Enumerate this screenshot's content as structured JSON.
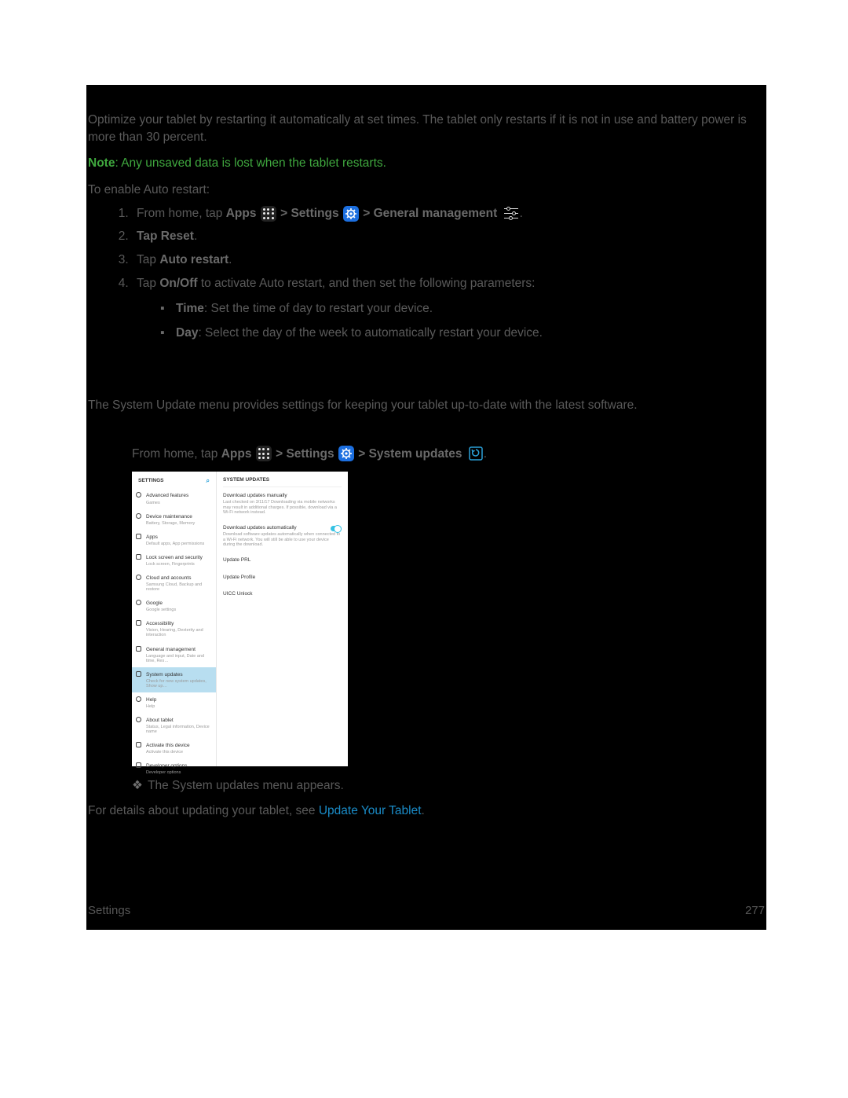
{
  "section1": {
    "intro": "Optimize your tablet by restarting it automatically at set times. The tablet only restarts if it is not in use and battery power is more than 30 percent.",
    "noteLabel": "Note",
    "noteText": ": Any unsaved data is lost when the tablet restarts.",
    "enableLine": "To enable Auto restart:",
    "step1_pre": "From home, tap ",
    "apps": "Apps",
    "gt": " > ",
    "settings": "Settings",
    "genmgmt": "General management",
    "step2_a": "Tap Reset",
    "step2_b": ".",
    "step3_a": "Tap ",
    "step3_b": "Auto restart",
    "step3_c": ".",
    "step4_a": "Tap ",
    "step4_b": "On/Off",
    "step4_c": " to activate Auto restart, and then set the following parameters:",
    "bullet1_a": "Time",
    "bullet1_b": ": Set the time of day to restart your device.",
    "bullet2_a": "Day",
    "bullet2_b": ": Select the day of the week to automatically restart your device."
  },
  "section2": {
    "intro": "The System Update menu provides settings for keeping your tablet up-to-date with the latest software.",
    "step1_pre": "From home, tap ",
    "apps": "Apps",
    "gt": " > ",
    "settings": "Settings",
    "sysupd": "System updates",
    "result": "The System updates menu appears.",
    "details_pre": "For details about updating your tablet, see ",
    "linkText": "Update Your Tablet",
    "details_post": "."
  },
  "mock": {
    "sideHeader": "SETTINGS",
    "mainHeader": "SYSTEM UPDATES",
    "sideItems": [
      {
        "title": "Advanced features",
        "sub": "Games",
        "color": "c-orange",
        "shape": "circle"
      },
      {
        "title": "Device maintenance",
        "sub": "Battery, Storage, Memory",
        "color": "c-teal",
        "shape": "circle"
      },
      {
        "title": "Apps",
        "sub": "Default apps, App permissions",
        "color": "c-pink",
        "shape": ""
      },
      {
        "title": "Lock screen and security",
        "sub": "Lock screen, Fingerprints",
        "color": "c-blue",
        "shape": ""
      },
      {
        "title": "Cloud and accounts",
        "sub": "Samsung Cloud, Backup and restore",
        "color": "c-orange2",
        "shape": "circle"
      },
      {
        "title": "Google",
        "sub": "Google settings",
        "color": "c-blue2",
        "shape": "circle"
      },
      {
        "title": "Accessibility",
        "sub": "Vision, Hearing, Dexterity and interaction",
        "color": "c-green",
        "shape": ""
      },
      {
        "title": "General management",
        "sub": "Language and input, Date and time, Res…",
        "color": "c-purple",
        "shape": ""
      },
      {
        "title": "System updates",
        "sub": "Check for new system updates, Show up…",
        "color": "c-cyan",
        "shape": "",
        "active": true
      },
      {
        "title": "Help",
        "sub": "Help",
        "color": "c-yellow",
        "shape": "circle"
      },
      {
        "title": "About tablet",
        "sub": "Status, Legal information, Device name",
        "color": "c-gray",
        "shape": "circle"
      },
      {
        "title": "Activate this device",
        "sub": "Activate this device",
        "color": "c-blue3",
        "shape": ""
      },
      {
        "title": "Developer options",
        "sub": "Developer options",
        "color": "c-gray2",
        "shape": ""
      }
    ],
    "mainItems": [
      {
        "t": "Download updates manually",
        "s": "Last checked on 3/11/17\nDownloading via mobile networks may result in additional charges. If possible, download via a Wi-Fi network instead."
      },
      {
        "t": "Download updates automatically",
        "s": "Download software updates automatically when connected to a Wi-Fi network. You will still be able to use your device during the download.",
        "toggle": true
      },
      {
        "t": "Update PRL",
        "s": ""
      },
      {
        "t": "Update Profile",
        "s": ""
      },
      {
        "t": "UICC Unlock",
        "s": ""
      }
    ]
  },
  "footer": {
    "left": "Settings",
    "right": "277"
  }
}
